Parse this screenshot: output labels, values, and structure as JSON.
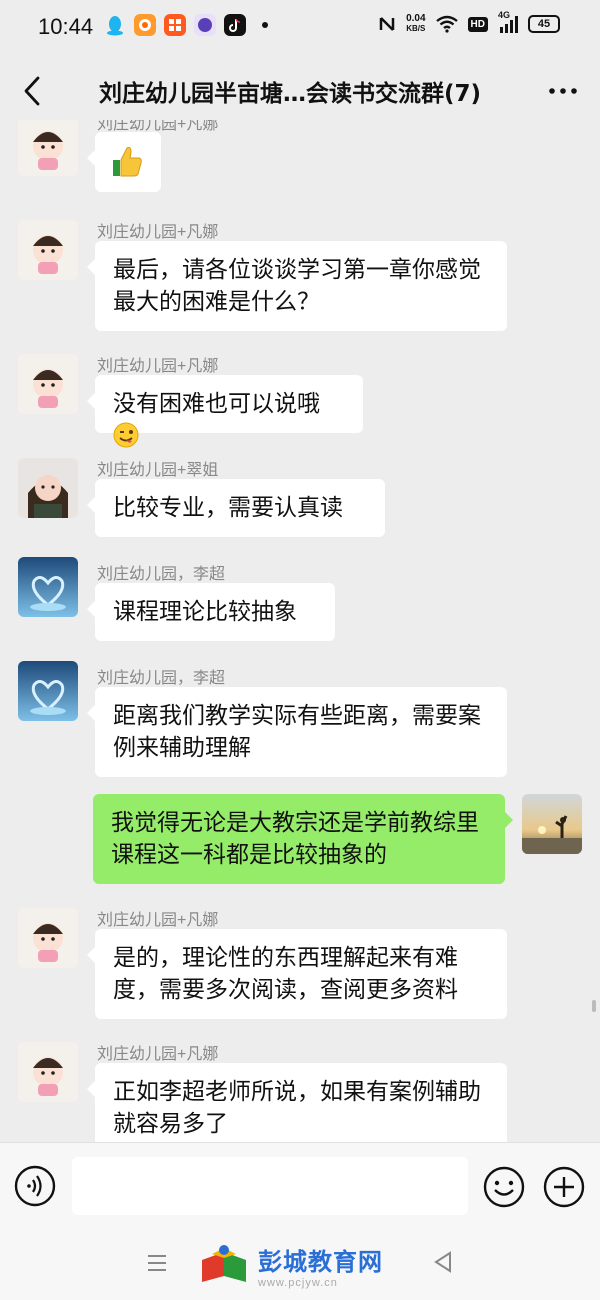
{
  "status_bar": {
    "time": "10:44",
    "net_speed_value": "0.04",
    "net_speed_unit": "KB/S",
    "hd_label": "HD",
    "signal_label": "4G",
    "battery": "45"
  },
  "header": {
    "title": "刘庄幼儿园半亩塘…会读书交流群(7)"
  },
  "messages": [
    {
      "sender": "刘庄幼儿园+凡娜",
      "text": "",
      "emoji": "thumbs-up"
    },
    {
      "sender": "刘庄幼儿园+凡娜",
      "text": "最后，请各位谈谈学习第一章你感觉最大的困难是什么？"
    },
    {
      "sender": "刘庄幼儿园+凡娜",
      "text": "没有困难也可以说哦",
      "emoji": "winking-face-with-tongue"
    },
    {
      "sender": "刘庄幼儿园+翠姐",
      "text": "比较专业，需要认真读"
    },
    {
      "sender": "刘庄幼儿园，李超",
      "text": "课程理论比较抽象"
    },
    {
      "sender": "刘庄幼儿园，李超",
      "text": "距离我们教学实际有些距离，需要案例来辅助理解"
    },
    {
      "sender": "",
      "text": "我觉得无论是大教宗还是学前教综里课程这一科都是比较抽象的",
      "self": true
    },
    {
      "sender": "刘庄幼儿园+凡娜",
      "text": "是的，理论性的东西理解起来有难度，需要多次阅读，查阅更多资料"
    },
    {
      "sender": "刘庄幼儿园+凡娜",
      "text": "正如李超老师所说，如果有案例辅助就容易多了"
    }
  ],
  "input": {
    "value": ""
  },
  "watermark": {
    "name": "彭城教育网",
    "url": "www.pcjyw.cn"
  },
  "colors": {
    "background": "#ededed",
    "self_bubble": "#95ec69",
    "other_bubble": "#ffffff",
    "watermark": "#2a6fd6"
  }
}
